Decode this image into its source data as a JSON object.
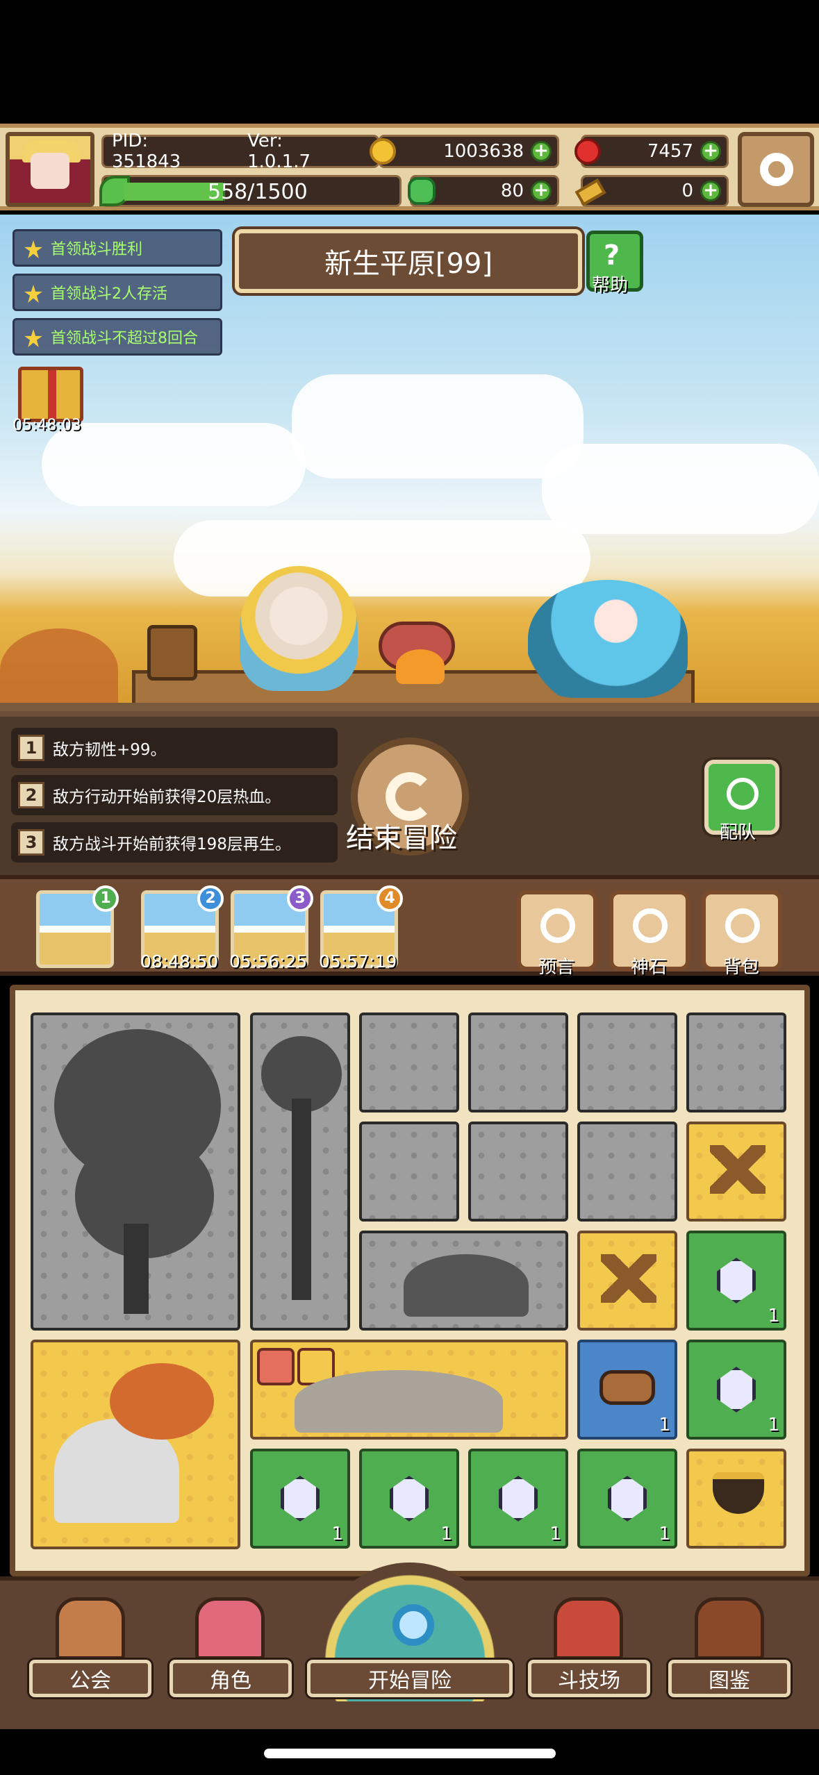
{
  "top_bar": {
    "pid": "PID: 351843",
    "version": "Ver: 1.0.1.7",
    "coins": "1003638",
    "rubies": "7457",
    "exp": "558/1500",
    "exp_progress": 0.372,
    "clovers": "80",
    "keys": "0"
  },
  "quests": [
    "首领战斗胜利",
    "首领战斗2人存活",
    "首领战斗不超过8回合"
  ],
  "gift_timer": "05:48:03",
  "stage_title": "新生平原[99]",
  "help_label": "帮助",
  "buffs": [
    {
      "num": "1",
      "text": "敌方韧性+99。"
    },
    {
      "num": "2",
      "text": "敌方行动开始前获得20层热血。"
    },
    {
      "num": "3",
      "text": "敌方战斗开始前获得198层再生。"
    }
  ],
  "end_adventure_label": "结束冒险",
  "team_label": "配队",
  "rewards": [
    {
      "badge": "1",
      "timer": "",
      "color": "#4fae4f"
    },
    {
      "badge": "2",
      "timer": "08:48:50",
      "color": "#3c8fd8"
    },
    {
      "badge": "3",
      "timer": "05:56:25",
      "color": "#8a5bc9"
    },
    {
      "badge": "4",
      "timer": "05:57:19",
      "color": "#e08a2a"
    }
  ],
  "actions": {
    "prophecy": "预言",
    "god_stone": "神石",
    "backpack": "背包"
  },
  "grid_counts": {
    "crystal_right_1": "1",
    "crystal_right_2": "1",
    "log": "1",
    "crystal_row_1": "1",
    "crystal_row_2": "1",
    "crystal_row_3": "1",
    "crystal_row_4": "1"
  },
  "nav": {
    "guild": "公会",
    "character": "角色",
    "start_adventure": "开始冒险",
    "arena": "斗技场",
    "codex": "图鉴"
  }
}
